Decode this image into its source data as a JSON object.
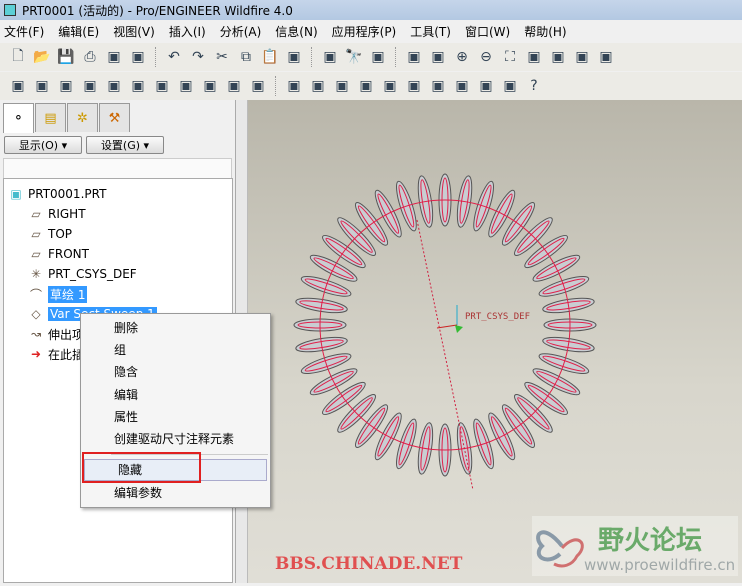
{
  "window": {
    "title": "PRT0001 (活动的) - Pro/ENGINEER Wildfire 4.0"
  },
  "menu": [
    "文件(F)",
    "编辑(E)",
    "视图(V)",
    "插入(I)",
    "分析(A)",
    "信息(N)",
    "应用程序(P)",
    "工具(T)",
    "窗口(W)",
    "帮助(H)"
  ],
  "toolbar1": [
    "new",
    "open",
    "save",
    "print",
    "email",
    "email-link",
    "undo",
    "redo",
    "cut",
    "copy",
    "paste",
    "paste-special",
    "regenerate",
    "find",
    "select-box",
    "repaint",
    "spin-center",
    "zoom-in",
    "zoom-out",
    "refit",
    "orient",
    "saved-views",
    "layers",
    "model-tree-settings"
  ],
  "toolbar2": [
    "measure-distance",
    "measure-angle",
    "measure-area",
    "measure-diameter",
    "curve-analysis",
    "surface-analysis",
    "curvature",
    "shade-analysis",
    "draft",
    "saved-analysis",
    "delete-analysis",
    "appearance",
    "scene",
    "render",
    "lights",
    "room",
    "perspective",
    "model-appearance",
    "color-edit",
    "display-style",
    "spotlight",
    "query-help"
  ],
  "panel": {
    "tabs": [
      "model-tree",
      "folder-browser",
      "favorites",
      "connections"
    ],
    "show_button": "显示(O) ▾",
    "settings_button": "设置(G) ▾"
  },
  "tree": [
    {
      "label": "PRT0001.PRT",
      "icon": "part"
    },
    {
      "label": "RIGHT",
      "icon": "datum-plane"
    },
    {
      "label": "TOP",
      "icon": "datum-plane"
    },
    {
      "label": "FRONT",
      "icon": "datum-plane"
    },
    {
      "label": "PRT_CSYS_DEF",
      "icon": "csys"
    },
    {
      "label": "草绘 1",
      "icon": "sketch"
    },
    {
      "label": "Var Sect Sweep 1",
      "icon": "sweep"
    },
    {
      "label": "伸出项",
      "icon": "protrusion"
    },
    {
      "label": "在此插",
      "icon": "insert-here"
    }
  ],
  "context_menu": {
    "items": [
      "删除",
      "组",
      "隐含",
      "编辑",
      "属性",
      "创建驱动尺寸注释元素"
    ],
    "items2": [
      "隐藏",
      "编辑参数"
    ]
  },
  "viewport": {
    "csys_label": "PRT_CSYS_DEF"
  },
  "watermarks": {
    "site1": "BBS.CHINADE.NET",
    "site2_name": "野火论坛",
    "site2_url": "www.proewildfire.cn"
  }
}
